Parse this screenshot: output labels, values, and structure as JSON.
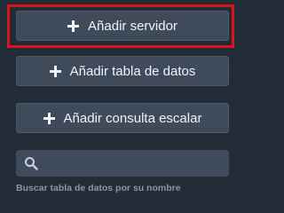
{
  "actions": {
    "add_server_label": "Añadir servidor",
    "add_table_label": "Añadir tabla de datos",
    "add_query_label": "Añadir consulta escalar",
    "icon": "plus-icon"
  },
  "search": {
    "value": "",
    "icon": "search-icon",
    "hint": "Buscar tabla de datos por su nombre"
  },
  "colors": {
    "background": "#222c36",
    "button": "#3f4b5b",
    "highlight": "#d9141c",
    "text": "#f2f4f7",
    "hint": "#8b97a6"
  }
}
